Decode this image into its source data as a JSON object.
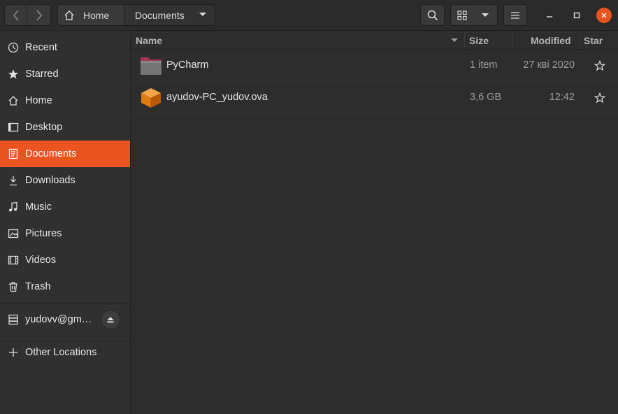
{
  "header": {
    "path": [
      "Home",
      "Documents"
    ]
  },
  "sidebar": {
    "items": [
      {
        "label": "Recent",
        "icon": "clock-icon"
      },
      {
        "label": "Starred",
        "icon": "star-icon"
      },
      {
        "label": "Home",
        "icon": "home-icon"
      },
      {
        "label": "Desktop",
        "icon": "desktop-icon"
      },
      {
        "label": "Documents",
        "icon": "document-icon",
        "active": true
      },
      {
        "label": "Downloads",
        "icon": "download-icon"
      },
      {
        "label": "Music",
        "icon": "music-icon"
      },
      {
        "label": "Pictures",
        "icon": "pictures-icon"
      },
      {
        "label": "Videos",
        "icon": "video-icon"
      },
      {
        "label": "Trash",
        "icon": "trash-icon"
      }
    ],
    "drive": {
      "label": "yudovv@gm…",
      "icon": "network-drive-icon"
    },
    "other_locations": {
      "label": "Other Locations",
      "icon": "plus-icon"
    }
  },
  "columns": {
    "name": "Name",
    "size": "Size",
    "modified": "Modified",
    "star": "Star"
  },
  "files": [
    {
      "name": "PyCharm",
      "size": "1 item",
      "modified": "27 кві 2020",
      "type": "folder"
    },
    {
      "name": "ayudov-PC_yudov.ova",
      "size": "3,6 GB",
      "modified": "12:42",
      "type": "virtualbox-appliance"
    }
  ],
  "colors": {
    "accent": "#e95420",
    "background": "#2d2d2d",
    "sidebar": "#303030"
  }
}
